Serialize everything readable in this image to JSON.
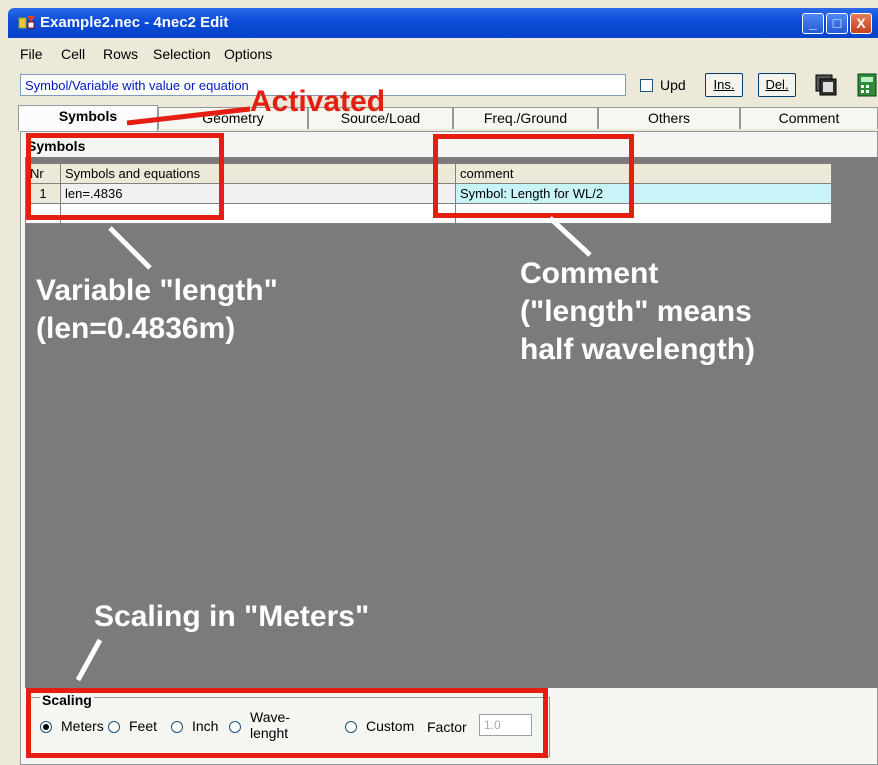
{
  "window": {
    "title": "Example2.nec - 4nec2 Edit",
    "controls": [
      "_",
      "□",
      "X"
    ]
  },
  "menu": [
    "File",
    "Cell",
    "Rows",
    "Selection",
    "Options"
  ],
  "toolbar": {
    "hint_text": "Symbol/Variable with value or equation",
    "upd_label": "Upd",
    "ins_label": "Ins.",
    "del_label": "Del."
  },
  "tabs": [
    {
      "label": "Symbols",
      "active": true
    },
    {
      "label": "Geometry",
      "active": false
    },
    {
      "label": "Source/Load",
      "active": false
    },
    {
      "label": "Freq./Ground",
      "active": false
    },
    {
      "label": "Others",
      "active": false
    },
    {
      "label": "Comment",
      "active": false
    }
  ],
  "symbols": {
    "section_title": "Symbols",
    "columns": [
      "Nr",
      "Symbols and equations",
      "comment"
    ],
    "rows": [
      {
        "nr": "1",
        "equation": "len=.4836",
        "comment": "Symbol: Length for WL/2"
      }
    ]
  },
  "scaling": {
    "title": "Scaling",
    "options": [
      "Meters",
      "Feet",
      "Inch",
      "Wave-\nlenght",
      "Custom"
    ],
    "selected": "Meters",
    "factor_label": "Factor",
    "factor_value": "1.0"
  },
  "annotations": {
    "activated": "Activated",
    "variable": "Variable \"length\"\n(len=0.4836m)",
    "comment": "Comment\n(\"length\" means\nhalf wavelength)",
    "scaling": "Scaling in \"Meters\""
  },
  "colors": {
    "annotation_red": "#e41e13",
    "titlebar_blue": "#0a4bd8",
    "highlight_cyan": "#c8f4f8"
  }
}
